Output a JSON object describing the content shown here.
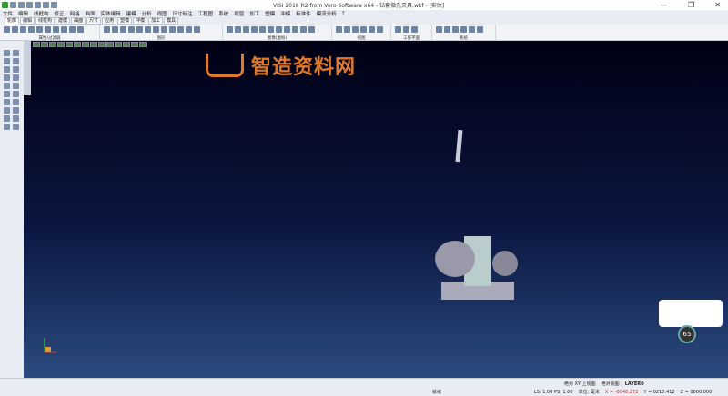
{
  "window": {
    "title": "VISI 2018 R2 from Vero Software x64 - 钻套微孔夹具.wkf - [实体]",
    "minimize": "—",
    "maximize": "❐",
    "close": "✕"
  },
  "menu": [
    "文件",
    "编辑",
    "线框构",
    "修正",
    "网格",
    "曲面",
    "实体编辑",
    "建模",
    "分析",
    "视图",
    "尺寸标注",
    "工程图",
    "系统",
    "视窗",
    "加工",
    "塑模",
    "冲模",
    "标准件",
    "模流分析",
    "?"
  ],
  "tabs": [
    "轮廓",
    "编辑",
    "线框构",
    "建模",
    "曲面",
    "尺寸",
    "应用",
    "塑模",
    "冲模",
    "加工",
    "模具"
  ],
  "ribbon_groups": [
    "属性/过滤器",
    "图形",
    "图像(虚拟)",
    "视图",
    "工作平面",
    "系统"
  ],
  "watermark": "智造资料网",
  "status": {
    "view_label": "绝对 XY 上视图",
    "view2": "绝对视图",
    "layer": "LAYER0",
    "ready": "就绪",
    "scale": "LS: 1.00 PS: 1.00",
    "units": "单位: 毫米",
    "x": "X = -0048.272",
    "y": "Y = 0210.412",
    "z": "Z = 0000.000"
  },
  "gauge": {
    "value": "65",
    "unit": "%"
  }
}
